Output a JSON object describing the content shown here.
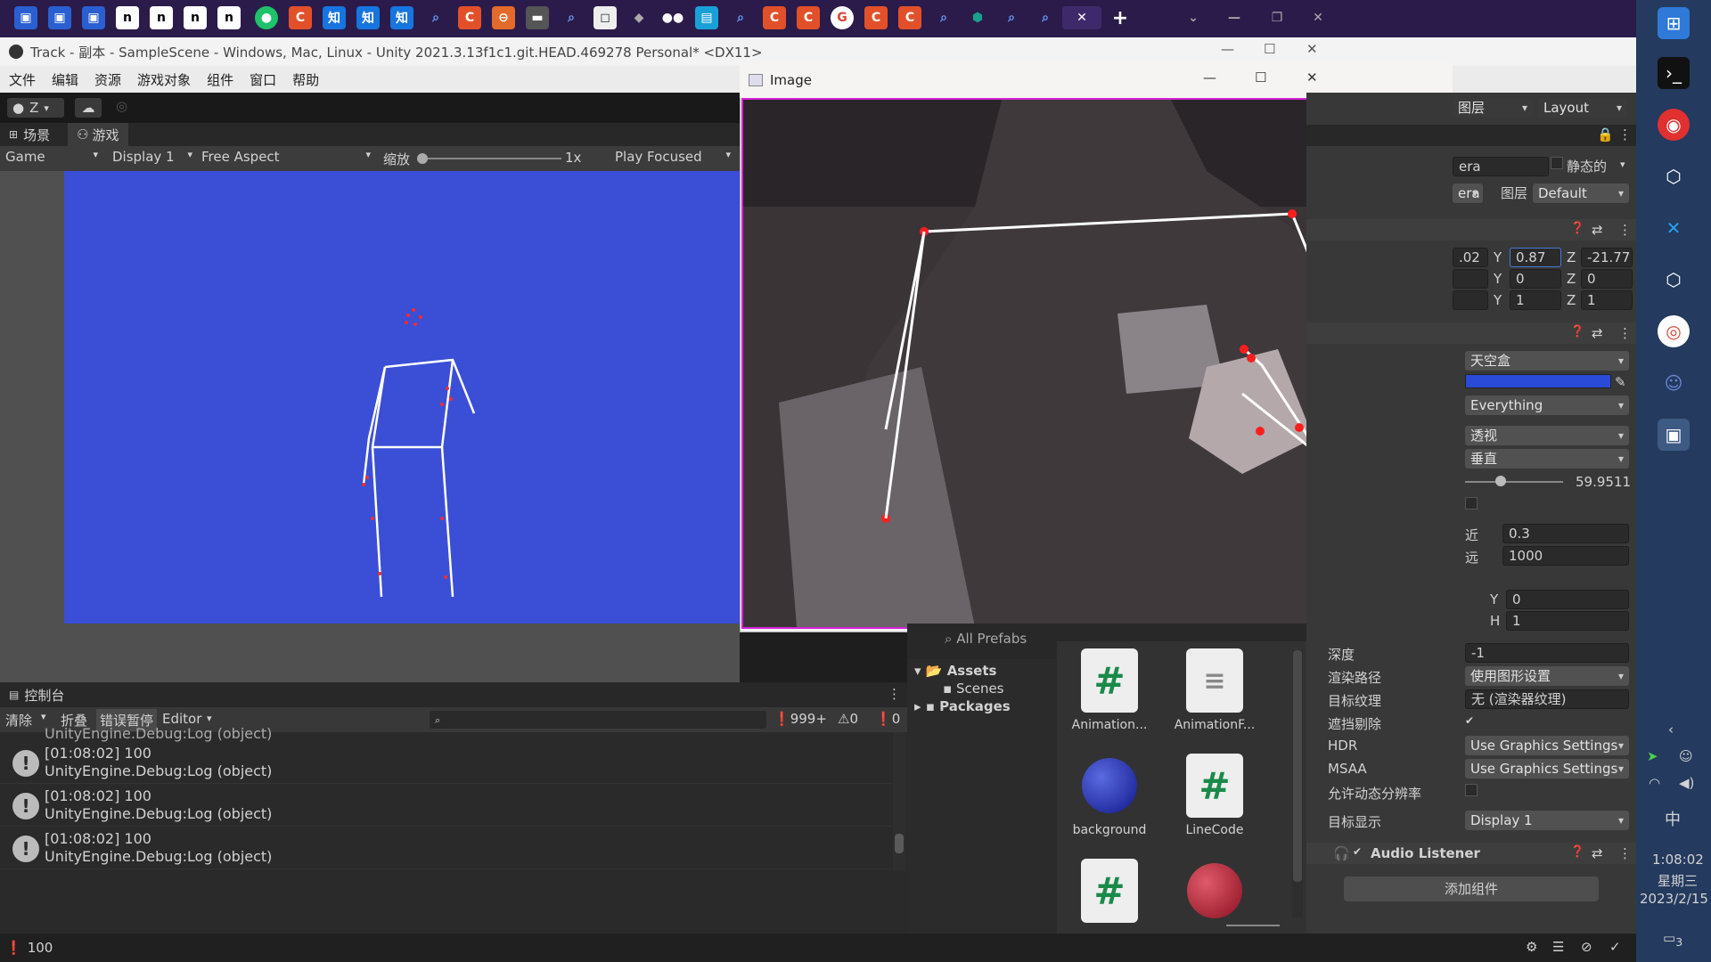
{
  "browser_tabs": [
    "calendar",
    "calendar",
    "calendar",
    "notion",
    "notion",
    "notion",
    "notion",
    "green",
    "red-c",
    "zhi",
    "zhi",
    "zhi",
    "search",
    "red-c",
    "orange",
    "dark",
    "search",
    "white",
    "chat",
    "medium",
    "blue",
    "search",
    "red-c",
    "red-c",
    "google",
    "red-c",
    "red-c",
    "search",
    "teal",
    "search",
    "search",
    "active"
  ],
  "tab_icons": {
    "notion": "n",
    "zhi": "知",
    "search": "🔍",
    "redc": "C",
    "close": "✕",
    "plus": "+",
    "google": "G"
  },
  "unity": {
    "title": "Track - 副本 - SampleScene - Windows, Mac, Linux - Unity 2021.3.13f1c1.git.HEAD.469278 Personal* <DX11>",
    "menu": [
      "文件",
      "编辑",
      "资源",
      "游戏对象",
      "组件",
      "窗口",
      "帮助"
    ],
    "account": "Z",
    "tabs": {
      "scene": "场景",
      "game": "游戏"
    },
    "game_bar": {
      "mode": "Game",
      "display": "Display 1",
      "aspect": "Free Aspect",
      "scale_label": "缩放",
      "scale_value": "1x",
      "play_mode": "Play Focused"
    }
  },
  "console": {
    "title": "控制台",
    "buttons": {
      "clear": "清除",
      "collapse": "折叠",
      "error_pause": "错误暂停",
      "editor": "Editor"
    },
    "counts": {
      "logs": "999+",
      "warnings": "0",
      "errors": "0"
    },
    "partial_line": "UnityEngine.Debug:Log (object)",
    "entries": [
      {
        "time": "[01:08:02] 100",
        "source": "UnityEngine.Debug:Log (object)"
      },
      {
        "time": "[01:08:02] 100",
        "source": "UnityEngine.Debug:Log (object)"
      },
      {
        "time": "[01:08:02] 100",
        "source": "UnityEngine.Debug:Log (object)"
      }
    ]
  },
  "status_bar": {
    "message": "100"
  },
  "project": {
    "search_label": "All Prefabs",
    "tree": [
      "Assets",
      "Scenes",
      "Packages"
    ],
    "assets": [
      {
        "name": "Animation...",
        "kind": "script"
      },
      {
        "name": "AnimationF...",
        "kind": "doc"
      },
      {
        "name": "background",
        "kind": "blue-sphere"
      },
      {
        "name": "LineCode",
        "kind": "script"
      },
      {
        "name": "",
        "kind": "script"
      },
      {
        "name": "",
        "kind": "red-sphere"
      }
    ]
  },
  "inspector": {
    "layers": "图层",
    "layout": "Layout",
    "name_partial": "era",
    "static": "静态的",
    "tag_partial": "era",
    "layer_label": "图层",
    "layer_value": "Default",
    "pos": {
      "x": ".02",
      "y": "0.87",
      "z": "-21.77"
    },
    "rot": {
      "y": "0",
      "z": "0"
    },
    "scale": {
      "y": "1",
      "z": "1"
    },
    "clear_flags": "天空盒",
    "culling_mask": "Everything",
    "projection": "透视",
    "fov_axis": "垂直",
    "fov": "59.9511",
    "near_label": "近",
    "near": "0.3",
    "far_label": "远",
    "far": "1000",
    "vp_y": "0",
    "vp_h": "1",
    "depth_label": "深度",
    "depth": "-1",
    "render_path_label": "渲染路径",
    "render_path": "使用图形设置",
    "target_tex_label": "目标纹理",
    "target_tex": "无 (渲染器纹理)",
    "occlusion_label": "遮挡剔除",
    "hdr_label": "HDR",
    "hdr": "Use Graphics Settings",
    "msaa_label": "MSAA",
    "msaa": "Use Graphics Settings",
    "dyn_res_label": "允许动态分辨率",
    "target_display_label": "目标显示",
    "target_display": "Display 1",
    "audio_listener": "Audio Listener",
    "add_component": "添加组件"
  },
  "image_window": {
    "title": "Image"
  },
  "taskbar": {
    "time": "1:08:02",
    "weekday": "星期三",
    "date": "2023/2/15",
    "ime": "中",
    "notif": "3"
  },
  "colors": {
    "accent": "#d622d6",
    "unity_blue": "#3a4fd6",
    "taskbar": "#243a5e"
  }
}
